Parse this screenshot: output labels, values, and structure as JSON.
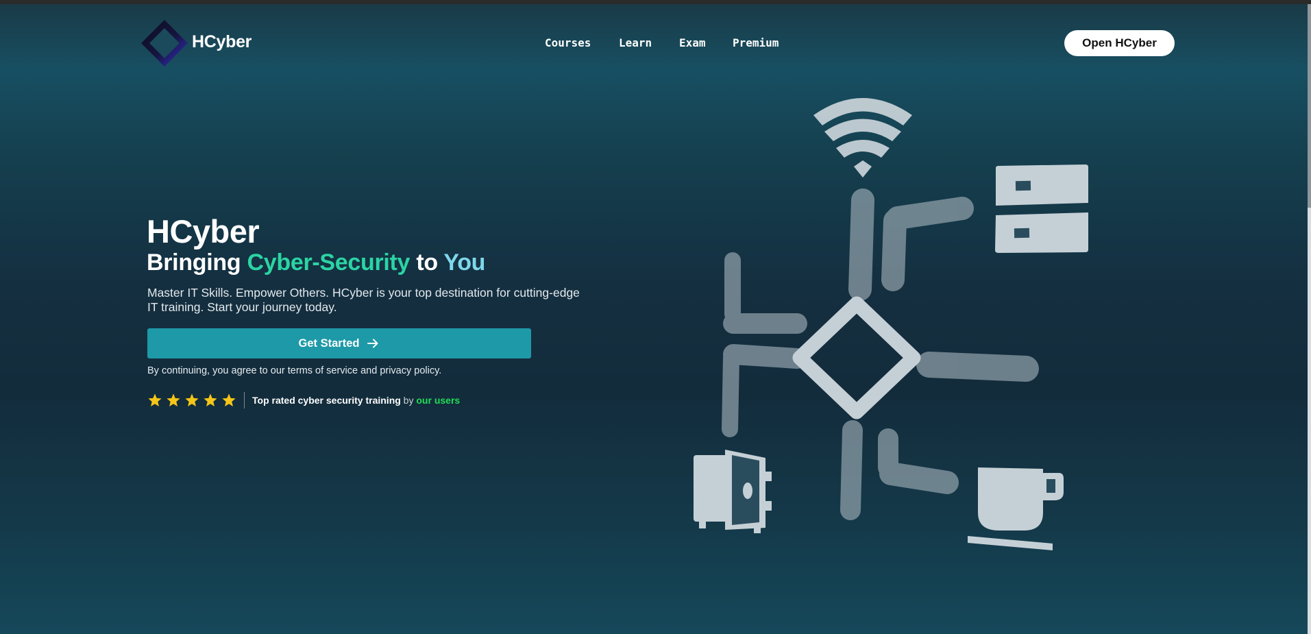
{
  "header": {
    "brand": "HCyber",
    "nav": [
      {
        "label": "Courses"
      },
      {
        "label": "Learn"
      },
      {
        "label": "Exam"
      },
      {
        "label": "Premium"
      }
    ],
    "open_button": "Open HCyber"
  },
  "hero": {
    "title": "HCyber",
    "subtitle_part1": "Bringing ",
    "subtitle_accent1": "Cyber-Security",
    "subtitle_part2": " to ",
    "subtitle_accent2": "You",
    "description": "Master IT Skills. Empower Others. HCyber is your top destination for cutting-edge IT training. Start your journey today.",
    "cta_label": "Get Started",
    "terms": "By continuing, you agree to our terms of service and privacy policy.",
    "rating": {
      "stars": 5,
      "text_main": "Top rated cyber security training",
      "text_by": " by ",
      "text_users": "our users"
    }
  },
  "colors": {
    "accent_green": "#2bd4a4",
    "accent_cyan": "#7fd7ea",
    "cta_bg": "#1e99a8",
    "star": "#f5c518",
    "users_green": "#22dd55"
  },
  "icons": [
    "hcyber-logo-icon",
    "arrow-right-icon",
    "star-icon",
    "wifi-icon",
    "server-icon",
    "safe-icon",
    "coffee-cup-icon",
    "diamond-icon"
  ]
}
